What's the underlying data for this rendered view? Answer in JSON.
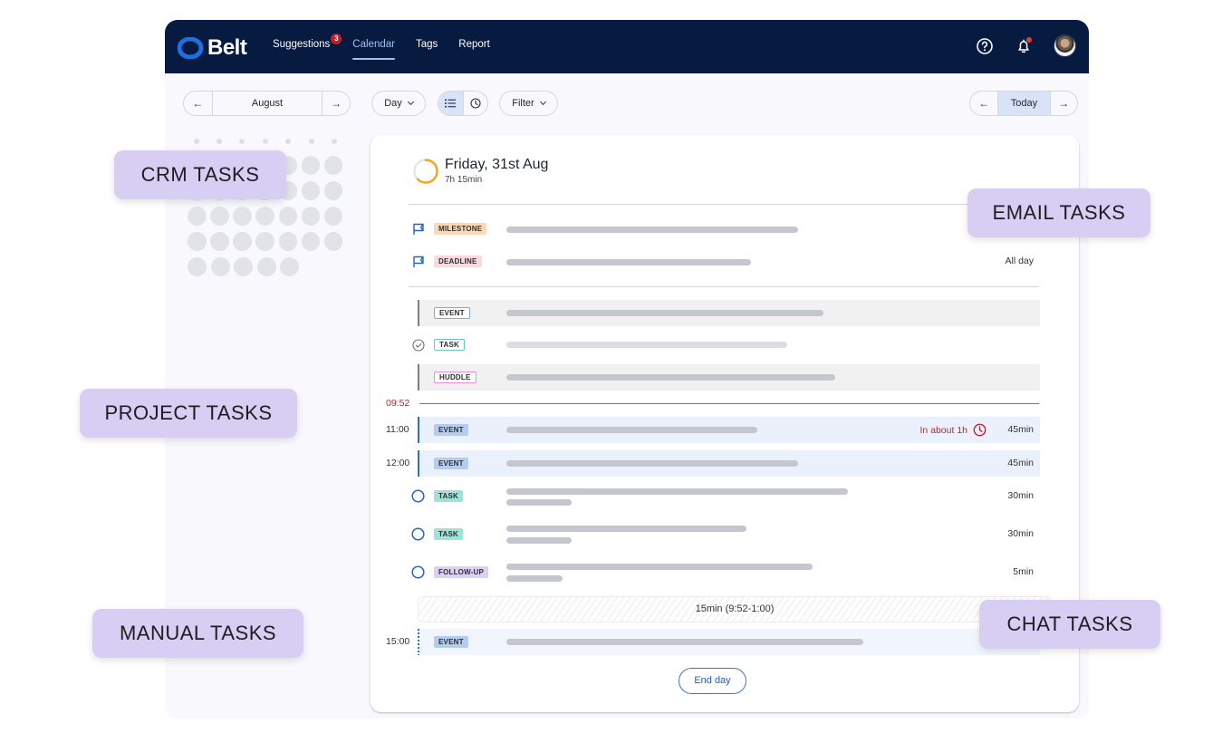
{
  "navbar": {
    "logo": "Belt",
    "links": [
      {
        "label": "Suggestions",
        "badge": "3",
        "active": false
      },
      {
        "label": "Calendar",
        "active": true
      },
      {
        "label": "Tags",
        "active": false
      },
      {
        "label": "Report",
        "active": false
      }
    ],
    "icons": [
      "help-icon",
      "bell-icon",
      "avatar"
    ]
  },
  "toolbar": {
    "month": "August",
    "prev_arrow": "←",
    "next_arrow": "→",
    "view_select": "Day",
    "view_modes": [
      "list-icon",
      "clock-icon"
    ],
    "active_view_mode": "list",
    "filter_label": "Filter",
    "today_label": "Today"
  },
  "day": {
    "title": "Friday, 31st Aug",
    "total": "7h 15min",
    "progress_fraction": 0.62
  },
  "allday": [
    {
      "tag": "MILESTONE",
      "tag_color": "#fbd9b8",
      "duration": ""
    },
    {
      "tag": "DEADLINE",
      "tag_color": "#fadadd",
      "duration": "All day"
    }
  ],
  "past": [
    {
      "type": "event",
      "tag": "EVENT",
      "tag_border": "#7fa8e6"
    },
    {
      "type": "task-done",
      "tag": "TASK",
      "tag_border": "#69c9be"
    },
    {
      "type": "event",
      "tag": "HUDDLE",
      "tag_border": "#ef8fd2"
    }
  ],
  "now": "09:52",
  "upcoming": [
    {
      "time": "11:00",
      "tag": "EVENT",
      "status": "In about 1h",
      "duration": "45min"
    },
    {
      "time": "12:00",
      "tag": "EVENT",
      "duration": "45min"
    },
    {
      "tag": "TASK",
      "duration": "30min"
    },
    {
      "tag": "TASK",
      "duration": "30min"
    },
    {
      "tag": "FOLLOW-UP",
      "duration": "5min"
    }
  ],
  "free_slot": "15min (9:52-1:00)",
  "later": [
    {
      "time": "15:00",
      "tag": "EVENT"
    }
  ],
  "end_day_label": "End day",
  "callouts": {
    "crm": "CRM TASKS",
    "email": "EMAIL TASKS",
    "project": "PROJECT TASKS",
    "manual": "MANUAL TASKS",
    "chat": "CHAT TASKS"
  },
  "colors": {
    "navbar": "#071a3f",
    "accent": "#1f5eb5",
    "now_line": "#c8202a",
    "callout": "#d8cdf2",
    "ring": "#f5a623"
  }
}
